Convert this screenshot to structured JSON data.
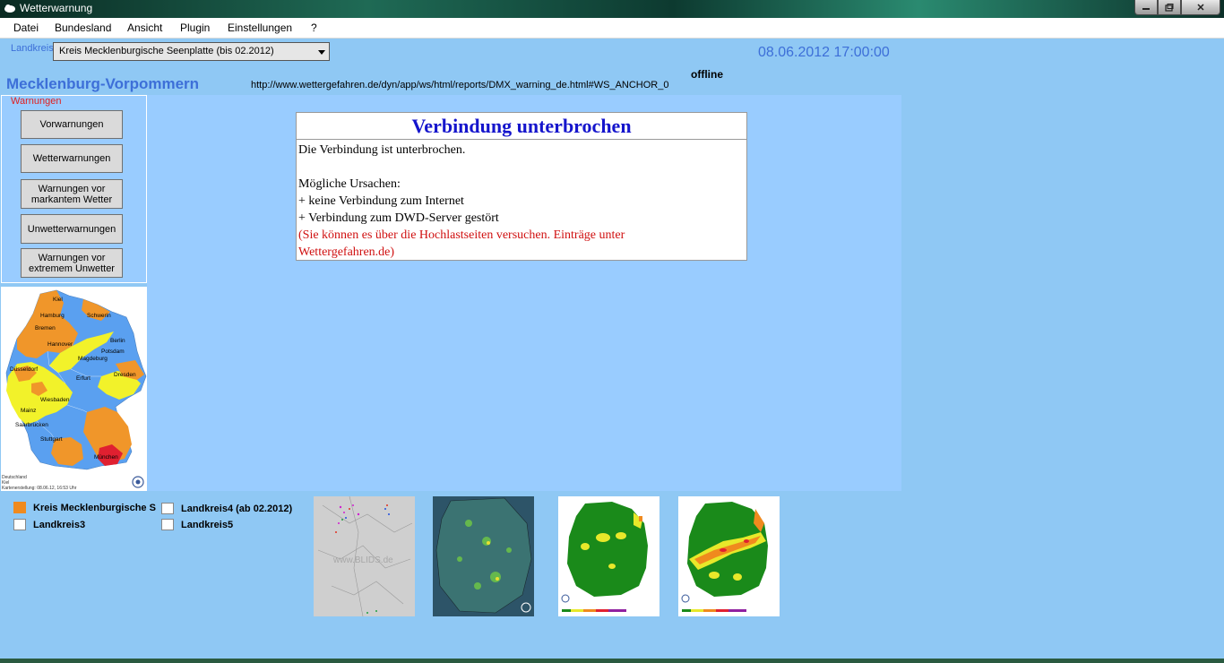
{
  "window": {
    "title": "Wetterwarnung",
    "minimize": "",
    "maximize": "",
    "close": "✕"
  },
  "menu": [
    "Datei",
    "Bundesland",
    "Ansicht",
    "Plugin",
    "Einstellungen",
    "?"
  ],
  "landkreis": {
    "label": "Landkreis",
    "selected": "Kreis Mecklenburgische Seenplatte (bis 02.2012)"
  },
  "datetime": "08.06.2012 17:00:00",
  "status": "offline",
  "bundesland": "Mecklenburg-Vorpommern",
  "url": "http://www.wettergefahren.de/dyn/app/ws/html/reports/DMX_warning_de.html#WS_ANCHOR_0",
  "warnungen": {
    "legend": "Warnungen",
    "buttons": [
      "Vorwarnungen",
      "Wetterwarnungen",
      "Warnungen vor markantem Wetter",
      "Unwetterwarnungen",
      "Warnungen vor extremem Unwetter"
    ]
  },
  "map": {
    "cities": [
      "Kiel",
      "Hamburg",
      "Schwerin",
      "Bremen",
      "Hannover",
      "Berlin",
      "Potsdam",
      "Magdeburg",
      "Düsseldorf",
      "Dresden",
      "Erfurt",
      "Wiesbaden",
      "Mainz",
      "Saarbrücken",
      "Stuttgart",
      "München"
    ],
    "footer1": "Deutschland",
    "footer2": "Kiel",
    "footer3": "Kartenerstellung: 08.06.12, 16:53 Uhr",
    "colors": {
      "blue": "#5aa0f0",
      "orange": "#f0962a",
      "yellow": "#f2f22a",
      "red": "#e02030"
    }
  },
  "legend": [
    {
      "label": "Kreis Mecklenburgische S",
      "color": "#f08a1e"
    },
    {
      "label": "Landkreis3",
      "color": "#ffffff"
    },
    {
      "label": "Landkreis4 (ab 02.2012)",
      "color": "#ffffff"
    },
    {
      "label": "Landkreis5",
      "color": "#ffffff"
    }
  ],
  "thumbnails": [
    {
      "name": "lightning",
      "text": "www.BLIDS.de"
    },
    {
      "name": "radar",
      "text": ""
    },
    {
      "name": "warnmap1",
      "text": ""
    },
    {
      "name": "warnmap2",
      "text": ""
    }
  ],
  "message": {
    "title": "Verbindung unterbrochen",
    "line1": "Die Verbindung ist unterbrochen.",
    "line2": "Mögliche Ursachen:",
    "line3": "+ keine Verbindung zum Internet",
    "line4": "+ Verbindung zum DWD-Server gestört",
    "line5": "(Sie können es über die Hochlastseiten versuchen. Einträge unter",
    "line6": "Wettergefahren.de)"
  }
}
